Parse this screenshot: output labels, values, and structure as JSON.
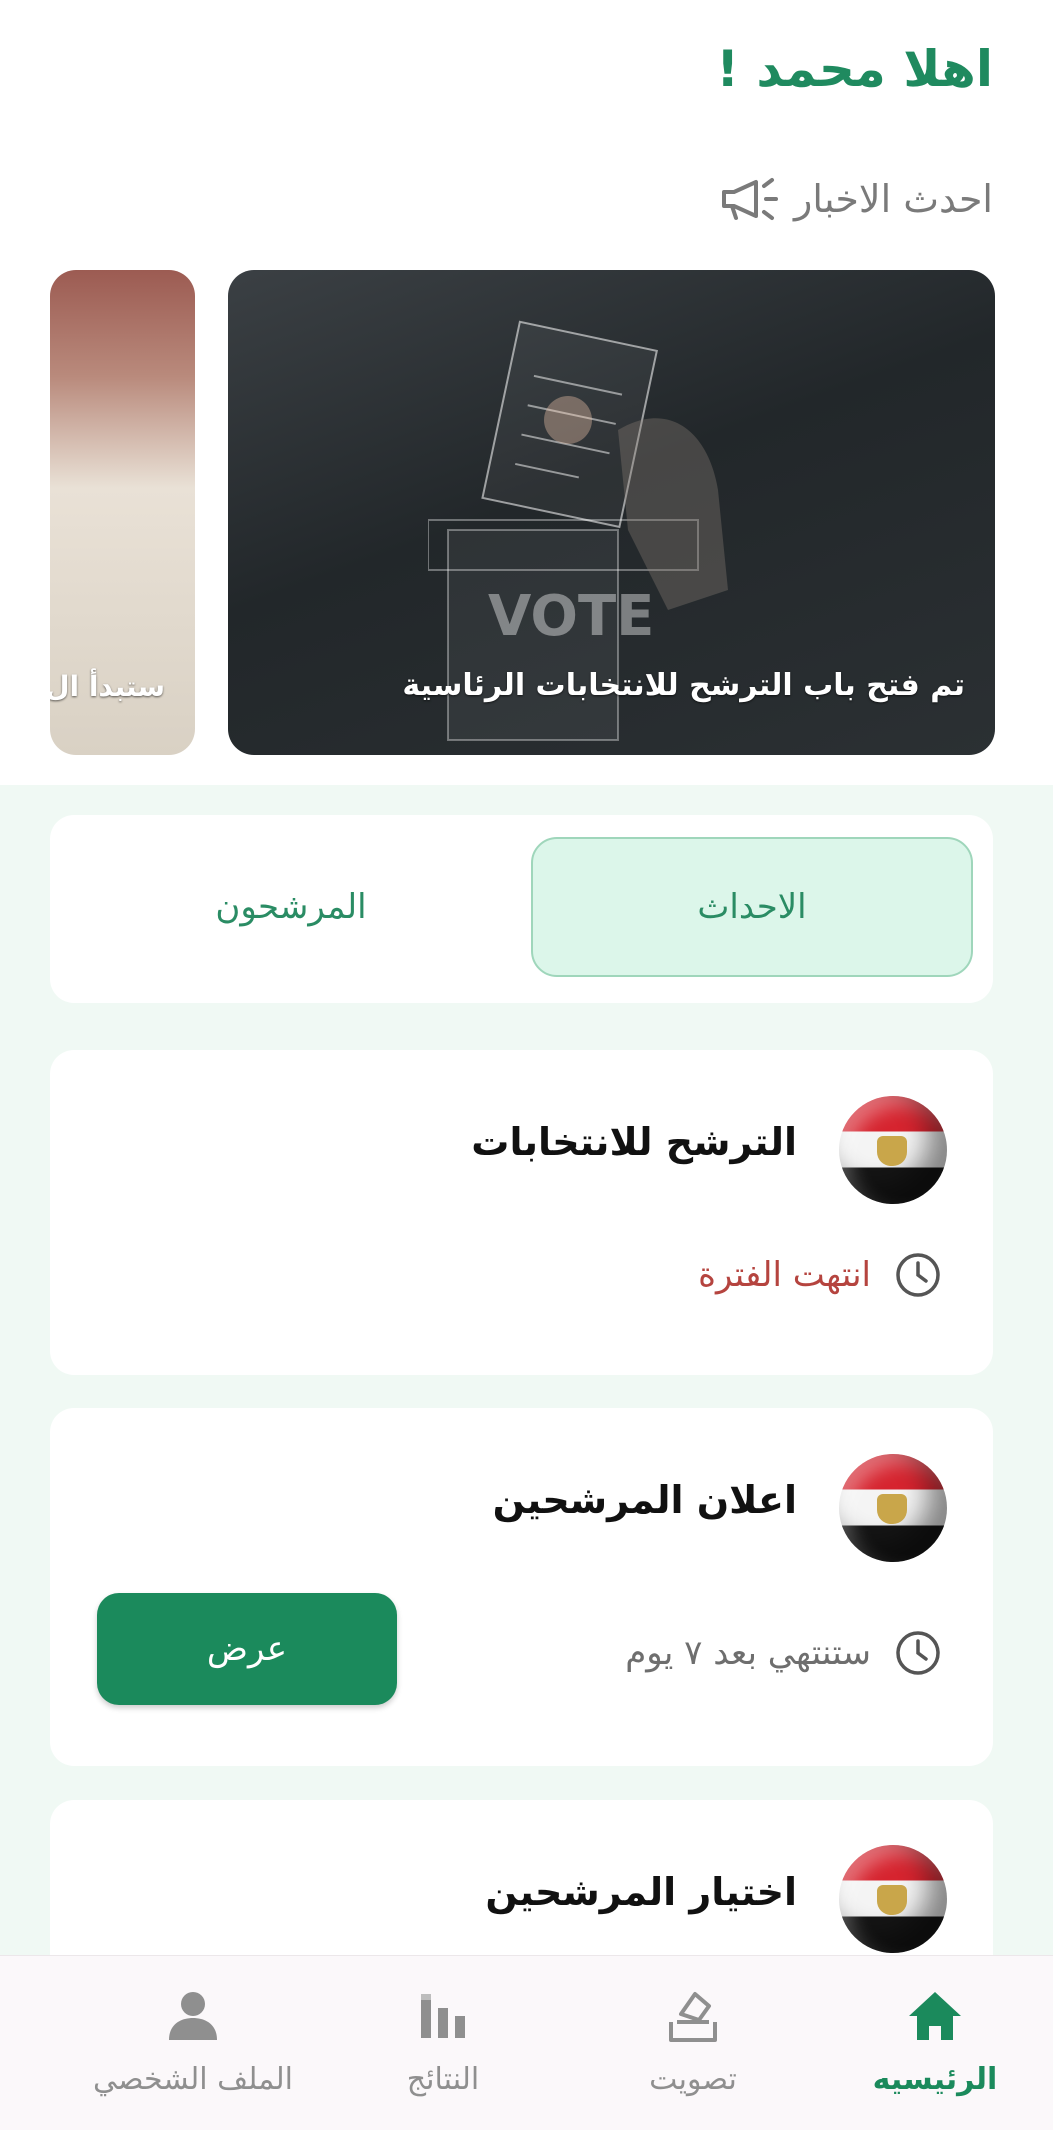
{
  "header": {
    "greeting": "اهلا  محمد !",
    "news_label": "احدث الاخبار"
  },
  "news": [
    {
      "caption": "تم فتح باب الترشح للانتخابات الرئاسية",
      "image_text": "VOTE"
    },
    {
      "caption": "ستبدأ ال"
    }
  ],
  "tabs": {
    "active": "الاحداث",
    "inactive": "المرشحون"
  },
  "events": [
    {
      "title": "الترشح للانتخابات",
      "status": "انتهت  الفترة",
      "status_color": "#b5443f"
    },
    {
      "title": "اعلان المرشحين",
      "status": "ستنتهي بعد ٧ يوم",
      "status_color": "#6e6e6e",
      "action": "عرض"
    },
    {
      "title": "اختيار المرشحين"
    }
  ],
  "bottom_nav": [
    {
      "label": "الرئيسيه",
      "icon": "home-icon",
      "active": true
    },
    {
      "label": "تصويت",
      "icon": "ballot-icon",
      "active": false
    },
    {
      "label": "النتائج",
      "icon": "results-icon",
      "active": false
    },
    {
      "label": "الملف الشخصي",
      "icon": "profile-icon",
      "active": false
    }
  ],
  "colors": {
    "primary": "#1b8a5c",
    "tab_active_bg": "#dcf6ea",
    "section_bg": "#f0f9f4",
    "ended_status": "#b5443f"
  }
}
